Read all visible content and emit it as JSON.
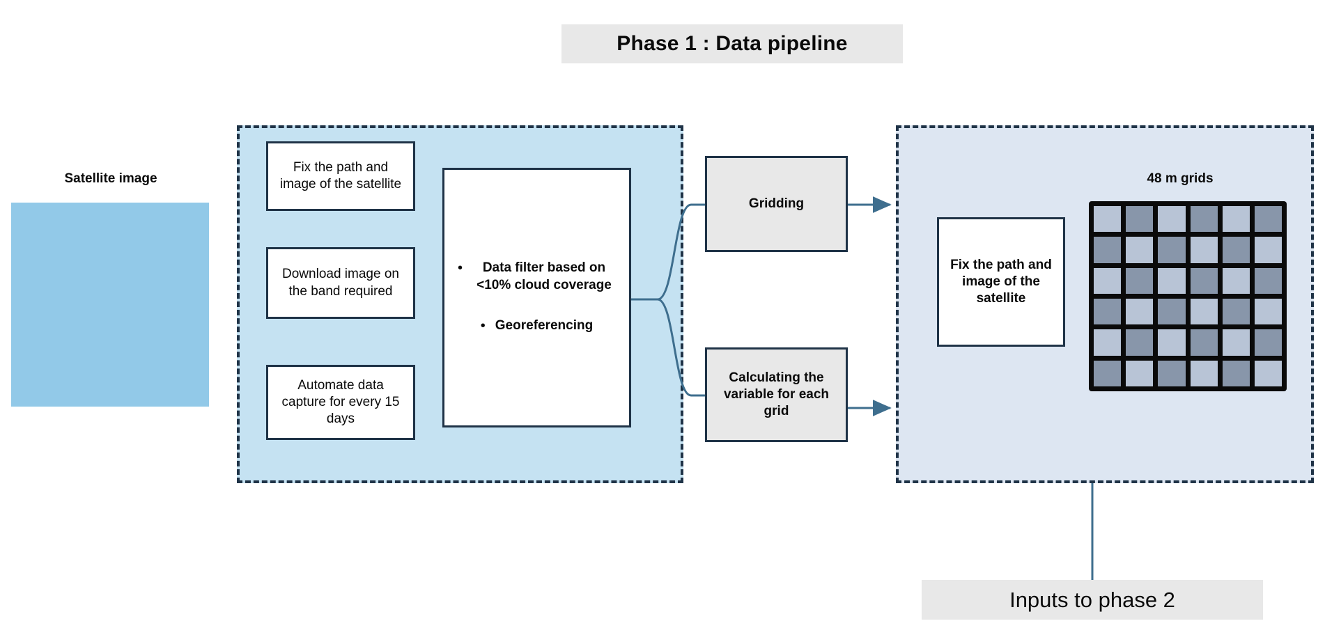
{
  "title": {
    "text": "Phase 1 : Data pipeline"
  },
  "satellite": {
    "label": "Satellite image",
    "swatch_color": "#92C9E8"
  },
  "left_panel": {
    "fill_color": "#C5E2F2",
    "border_color": "#1F3347",
    "steps": [
      {
        "label": "Fix the path and image of the satellite"
      },
      {
        "label": "Download image on the band required"
      },
      {
        "label": "Automate data capture for every 15 days"
      }
    ],
    "processing_box": {
      "bullets": [
        "Data filter based on <10% cloud coverage",
        "Georeferencing"
      ],
      "bullet_glyph": "•"
    }
  },
  "middle_stage": {
    "boxes": [
      {
        "label": "Gridding",
        "fill_color": "#E8E8E8"
      },
      {
        "label": "Calculating the variable for each grid",
        "fill_color": "#E8E8E8"
      }
    ]
  },
  "right_panel": {
    "fill_color": "#DDE6F2",
    "border_color": "#1F3347",
    "box": {
      "label": "Fix the path and image of the satellite"
    },
    "grid": {
      "label": "48 m grids",
      "rows": 6,
      "cols": 6,
      "light_color": "#B8C4D6",
      "dark_color": "#8896AA",
      "line_color": "#0A0A0A",
      "cells": [
        [
          "light",
          "dark",
          "light",
          "dark",
          "light",
          "dark"
        ],
        [
          "dark",
          "light",
          "dark",
          "light",
          "dark",
          "light"
        ],
        [
          "light",
          "dark",
          "light",
          "dark",
          "light",
          "dark"
        ],
        [
          "dark",
          "light",
          "dark",
          "light",
          "dark",
          "light"
        ],
        [
          "light",
          "dark",
          "light",
          "dark",
          "light",
          "dark"
        ],
        [
          "dark",
          "light",
          "dark",
          "light",
          "dark",
          "light"
        ]
      ]
    }
  },
  "footer": {
    "label": "Inputs to phase 2"
  },
  "connectors": {
    "color": "#3E6E8E"
  }
}
